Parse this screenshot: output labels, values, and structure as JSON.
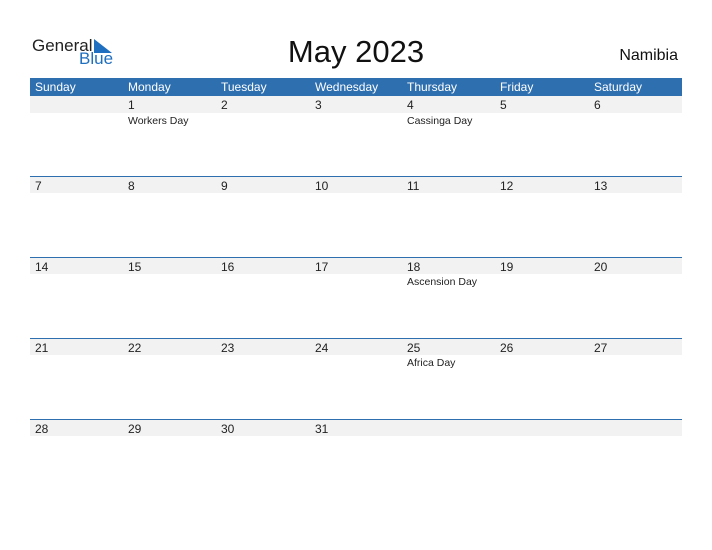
{
  "logo": {
    "word1": "General",
    "word2": "Blue"
  },
  "title": "May 2023",
  "country": "Namibia",
  "weekdays": [
    "Sunday",
    "Monday",
    "Tuesday",
    "Wednesday",
    "Thursday",
    "Friday",
    "Saturday"
  ],
  "weeks": [
    {
      "days": [
        "",
        "1",
        "2",
        "3",
        "4",
        "5",
        "6"
      ],
      "holidays": [
        "",
        "Workers Day",
        "",
        "",
        "Cassinga Day",
        "",
        ""
      ]
    },
    {
      "days": [
        "7",
        "8",
        "9",
        "10",
        "11",
        "12",
        "13"
      ],
      "holidays": [
        "",
        "",
        "",
        "",
        "",
        "",
        ""
      ]
    },
    {
      "days": [
        "14",
        "15",
        "16",
        "17",
        "18",
        "19",
        "20"
      ],
      "holidays": [
        "",
        "",
        "",
        "",
        "Ascension Day",
        "",
        ""
      ]
    },
    {
      "days": [
        "21",
        "22",
        "23",
        "24",
        "25",
        "26",
        "27"
      ],
      "holidays": [
        "",
        "",
        "",
        "",
        "Africa Day",
        "",
        ""
      ]
    },
    {
      "days": [
        "28",
        "29",
        "30",
        "31",
        "",
        "",
        ""
      ],
      "holidays": [
        "",
        "",
        "",
        "",
        "",
        "",
        ""
      ]
    }
  ],
  "colors": {
    "accent": "#2e6fb0",
    "logo_blue": "#1f6fc0",
    "strip": "#f2f2f2"
  }
}
